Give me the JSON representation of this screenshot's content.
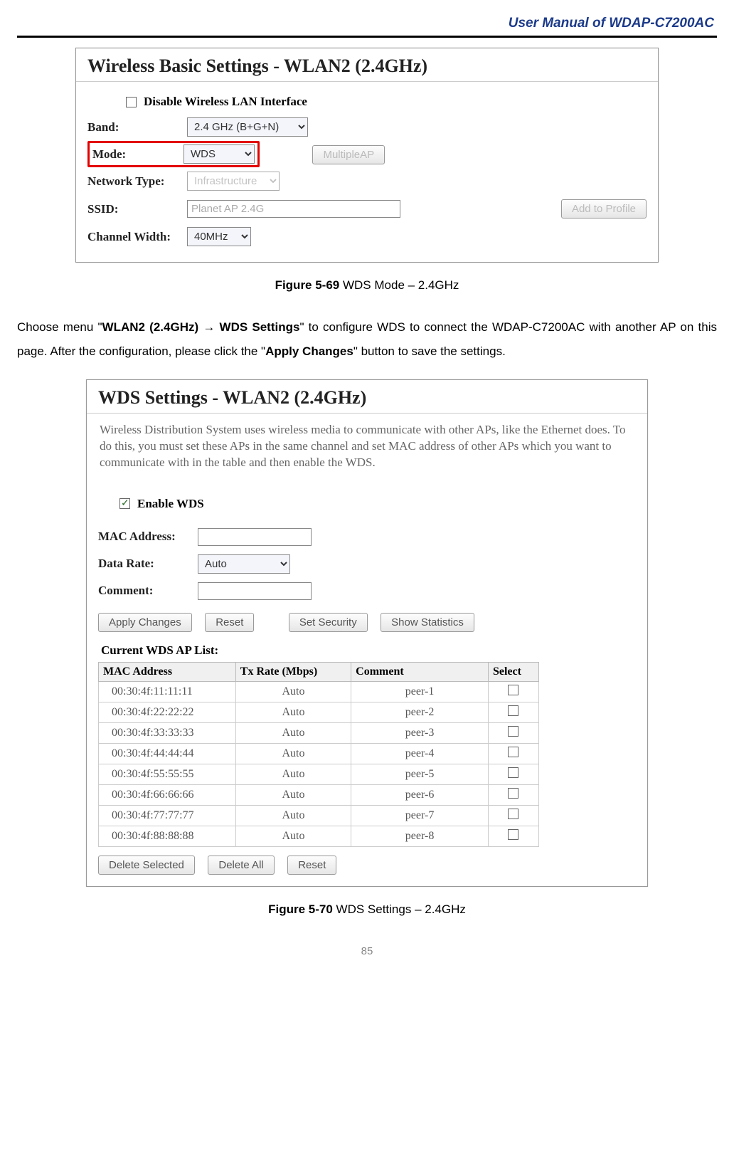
{
  "header": {
    "title": "User Manual of WDAP-C7200AC"
  },
  "fig1": {
    "panel_title": "Wireless Basic Settings - WLAN2 (2.4GHz)",
    "disable_label": "Disable Wireless LAN Interface",
    "band_label": "Band:",
    "band_value": "2.4 GHz (B+G+N)",
    "mode_label": "Mode:",
    "mode_value": "WDS",
    "multiple_ap": "MultipleAP",
    "nettype_label": "Network Type:",
    "nettype_value": "Infrastructure",
    "ssid_label": "SSID:",
    "ssid_placeholder": "Planet AP 2.4G",
    "add_profile": "Add to Profile",
    "cw_label": "Channel Width:",
    "cw_value": "40MHz",
    "caption_bold": "Figure 5-69",
    "caption_rest": " WDS Mode – 2.4GHz"
  },
  "para1": {
    "t1": "Choose menu \"",
    "b1": "WLAN2 (2.4GHz) ",
    "arrow": "→",
    "b2": " WDS Settings",
    "t2": "\" to configure WDS to connect the WDAP-C7200AC with another AP on this page. After the configuration, please click the \"",
    "b3": "Apply Changes",
    "t3": "\" button to save the settings."
  },
  "fig2": {
    "panel_title": "WDS Settings - WLAN2 (2.4GHz)",
    "desc": "Wireless Distribution System uses wireless media to communicate with other APs, like the Ethernet does. To do this, you must set these APs in the same channel and set MAC address of other APs which you want to communicate with in the table and then enable the WDS.",
    "enable_label": "Enable WDS",
    "mac_label": "MAC Address:",
    "rate_label": "Data Rate:",
    "rate_value": "Auto",
    "comment_label": "Comment:",
    "btn_apply": "Apply Changes",
    "btn_reset": "Reset",
    "btn_security": "Set Security",
    "btn_stats": "Show Statistics",
    "list_label": "Current WDS AP List:",
    "th_mac": "MAC Address",
    "th_rate": "Tx Rate (Mbps)",
    "th_comment": "Comment",
    "th_select": "Select",
    "rows": [
      {
        "mac": "00:30:4f:11:11:11",
        "rate": "Auto",
        "comment": "peer-1"
      },
      {
        "mac": "00:30:4f:22:22:22",
        "rate": "Auto",
        "comment": "peer-2"
      },
      {
        "mac": "00:30:4f:33:33:33",
        "rate": "Auto",
        "comment": "peer-3"
      },
      {
        "mac": "00:30:4f:44:44:44",
        "rate": "Auto",
        "comment": "peer-4"
      },
      {
        "mac": "00:30:4f:55:55:55",
        "rate": "Auto",
        "comment": "peer-5"
      },
      {
        "mac": "00:30:4f:66:66:66",
        "rate": "Auto",
        "comment": "peer-6"
      },
      {
        "mac": "00:30:4f:77:77:77",
        "rate": "Auto",
        "comment": "peer-7"
      },
      {
        "mac": "00:30:4f:88:88:88",
        "rate": "Auto",
        "comment": "peer-8"
      }
    ],
    "btn_delsel": "Delete Selected",
    "btn_delall": "Delete All",
    "btn_reset2": "Reset",
    "caption_bold": "Figure 5-70",
    "caption_rest": " WDS Settings – 2.4GHz"
  },
  "page_number": "85"
}
